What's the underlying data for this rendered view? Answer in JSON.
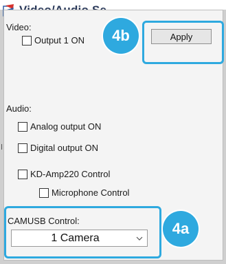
{
  "window": {
    "title": "Video/Audio Se"
  },
  "video": {
    "label": "Video:",
    "output1_label": "Output 1 ON"
  },
  "toolbar": {
    "apply_label": "Apply"
  },
  "audio": {
    "label": "Audio:",
    "analog_label": "Analog output ON",
    "digital_label": "Digital output ON",
    "kd_amp_label": "KD-Amp220 Control",
    "microphone_label": "Microphone Control"
  },
  "camusb": {
    "label": "CAMUSB Control:",
    "selected": "1 Camera"
  },
  "callouts": {
    "apply": "4b",
    "camusb": "4a"
  },
  "colors": {
    "accent": "#2ea9df",
    "title": "#2b3a5a",
    "panel": "#f4f4f4"
  },
  "icons": {
    "app": "video-audio-app-icon",
    "dropdown": "chevron-down-icon"
  }
}
